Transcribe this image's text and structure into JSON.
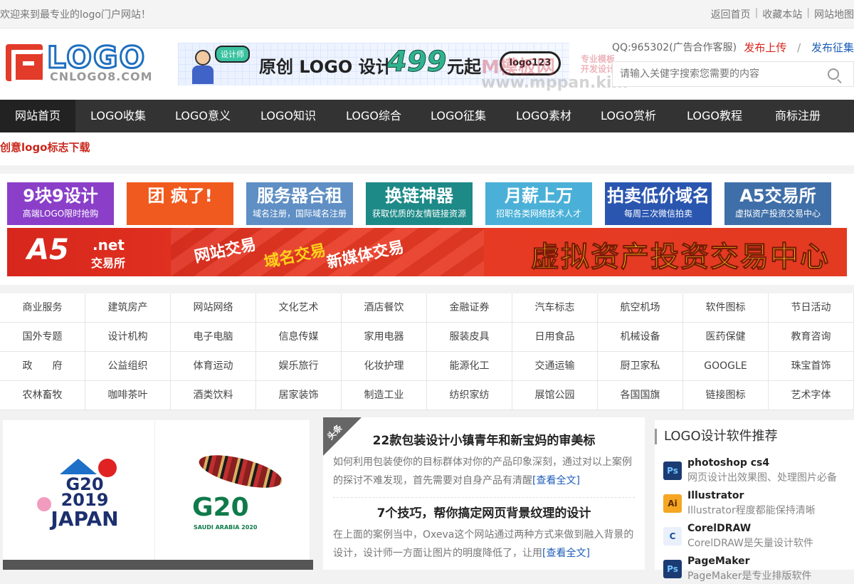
{
  "topbar": {
    "welcome": "欢迎来到最专业的logo门户网站！",
    "links": [
      "返回首页",
      "收藏本站",
      "网站地图"
    ]
  },
  "header": {
    "logo_word": "LOGO",
    "logo_sub": "CNLOGO8.COM",
    "banner": {
      "bubble": "设计师",
      "text1": "原创 LOGO 设计",
      "price": "499",
      "text2": "元起",
      "pill": "logo123"
    },
    "watermark": {
      "main": "M模板网",
      "side1": "专业模板",
      "side2": "开发设计",
      "url": "www.mppan.kim"
    },
    "qq": "QQ:965302(广告合作客服)",
    "publish_upload": "发布上传",
    "publish_collect": "发布征集",
    "search_placeholder": "请输入关健字搜索您需要的内容"
  },
  "nav": {
    "items": [
      {
        "label": "网站首页",
        "w": 106
      },
      {
        "label": "LOGO收集",
        "w": 120
      },
      {
        "label": "LOGO意义",
        "w": 118
      },
      {
        "label": "LOGO知识",
        "w": 122
      },
      {
        "label": "LOGO综合",
        "w": 118
      },
      {
        "label": "LOGO征集",
        "w": 120
      },
      {
        "label": "LOGO素材",
        "w": 120
      },
      {
        "label": "LOGO赏析",
        "w": 118
      },
      {
        "label": "LOGO教程",
        "w": 124
      },
      {
        "label": "商标注册",
        "w": 110
      }
    ]
  },
  "tagline": "创意logo标志下载",
  "ads": [
    {
      "big": "9块9设计",
      "small": "高端LOGO限时抢购",
      "bg": "#8b3fc9"
    },
    {
      "big": "团 疯了!",
      "small": "",
      "bg": "#f05a1e"
    },
    {
      "big": "服务器合租",
      "small": "域名注册，国际域名注册",
      "bg": "#5f8fc4"
    },
    {
      "big": "换链神器",
      "small": "获取优质的友情链接资源",
      "bg": "#1d8a88"
    },
    {
      "big": "月薪上万",
      "small": "招职各类网络技术人才",
      "bg": "#4ab0d8"
    },
    {
      "big": "拍卖低价域名",
      "small": "每周三次微信拍卖",
      "bg": "#2a56b0"
    },
    {
      "big": "A5交易所",
      "small": "虚拟资产投资交易中心",
      "bg": "#3f6fa8"
    }
  ],
  "wide_ad": {
    "brand": "A5",
    "net": ".net",
    "brand_sub": "交易所",
    "s1": "网站交易",
    "s2": "域名交易",
    "s3": "新媒体交易",
    "slogan": "虚拟资产投资交易中心"
  },
  "categories": [
    "商业服务",
    "建筑房产",
    "网站网络",
    "文化艺术",
    "酒店餐饮",
    "金融证券",
    "汽车标志",
    "航空机场",
    "软件图标",
    "节日活动",
    "国外专题",
    "设计机构",
    "电子电脑",
    "信息传媒",
    "家用电器",
    "服装皮具",
    "日用食品",
    "机械设备",
    "医药保健",
    "教育咨询",
    "政　　府",
    "公益组织",
    "体育运动",
    "娱乐旅行",
    "化妆护理",
    "能源化工",
    "交通运输",
    "厨卫家私",
    "GOOGLE",
    "珠宝首饰",
    "农林畜牧",
    "咖啡茶叶",
    "酒类饮料",
    "居家装饰",
    "制造工业",
    "纺织家纺",
    "展馆公园",
    "各国国旗",
    "链接图标",
    "艺术字体"
  ],
  "left_panel": {
    "img1": {
      "line1": "G20",
      "line2": "2019",
      "line3": "JAPAN"
    },
    "img2": {
      "big": "G20",
      "small": "SAUDI ARABIA 2020"
    }
  },
  "mid_panel": {
    "corner": "头条",
    "articles": [
      {
        "title": "22款包装设计小镇青年和新宝妈的审美标",
        "body": "如何利用包装使你的目标群体对你的产品印象深刻，通过对以上案例的探讨不难发现，首先需要对自身产品有清醒",
        "more": "[查看全文]"
      },
      {
        "title": "7个技巧，帮你搞定网页背景纹理的设计",
        "body": "在上面的案例当中，Oxeva这个网站通过两种方式来做到融入背景的设计，设计师一方面让图片的明度降低了，让用",
        "more": "[查看全文]"
      }
    ]
  },
  "right_panel": {
    "title": "LOGO设计软件推荐",
    "items": [
      {
        "icon": "Ps",
        "name": "photoshop cs4",
        "desc": "网页设计出效果图、处理图片必备",
        "bg": "#1b3b73",
        "fg": "#6fc3ff"
      },
      {
        "icon": "Ai",
        "name": "Illustrator",
        "desc": "Illustrator程度都能保持清晰",
        "bg": "#f5a623",
        "fg": "#5a2c00"
      },
      {
        "icon": "C",
        "name": "CorelDRAW",
        "desc": "CorelDRAW是矢量设计软件",
        "bg": "#e9f0fb",
        "fg": "#1a4fa0"
      },
      {
        "icon": "Ps",
        "name": "PageMaker",
        "desc": "PageMaker是专业排版软件",
        "bg": "#1b3b73",
        "fg": "#6fc3ff"
      }
    ]
  }
}
